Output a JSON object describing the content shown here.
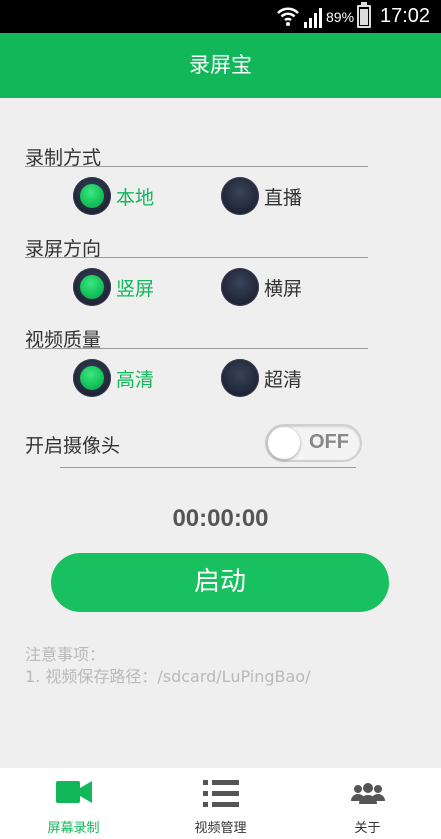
{
  "status_bar": {
    "battery": "89%",
    "time": "17:02"
  },
  "app": {
    "title": "录屏宝"
  },
  "sections": {
    "mode": {
      "label": "录制方式",
      "options": [
        {
          "label": "本地",
          "selected": true
        },
        {
          "label": "直播",
          "selected": false
        }
      ]
    },
    "orientation": {
      "label": "录屏方向",
      "options": [
        {
          "label": "竖屏",
          "selected": true
        },
        {
          "label": "横屏",
          "selected": false
        }
      ]
    },
    "quality": {
      "label": "视频质量",
      "options": [
        {
          "label": "高清",
          "selected": true
        },
        {
          "label": "超清",
          "selected": false
        }
      ]
    }
  },
  "camera": {
    "label": "开启摄像头",
    "state": "OFF"
  },
  "timer": "00:00:00",
  "start_button": "启动",
  "notes": {
    "title": "注意事项：",
    "line1": "1. 视频保存路径：/sdcard/LuPingBao/"
  },
  "tabs": [
    {
      "label": "屏幕录制",
      "icon": "video-camera-icon",
      "active": true
    },
    {
      "label": "视频管理",
      "icon": "list-icon",
      "active": false
    },
    {
      "label": "关于",
      "icon": "people-icon",
      "active": false
    }
  ],
  "colors": {
    "brand": "#12b75a",
    "button": "#19c05f"
  }
}
